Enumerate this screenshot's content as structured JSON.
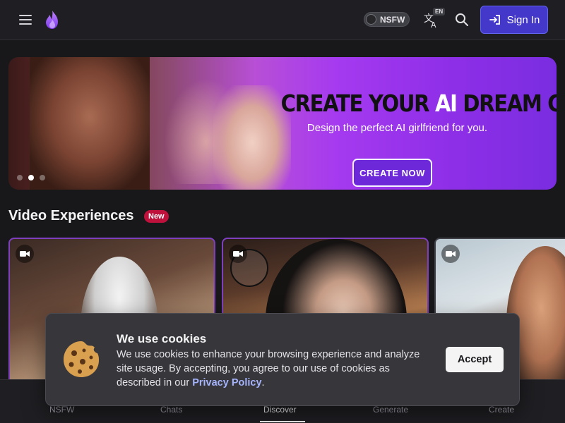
{
  "header": {
    "nsfw_toggle_label": "NSFW",
    "language_badge": "EN",
    "signin_label": "Sign In"
  },
  "banner": {
    "title_part1": "CREATE YOUR ",
    "title_ai": "AI",
    "title_part2": " DREAM GIRL",
    "subtitle": "Design the perfect AI girlfriend for you.",
    "cta_label": "CREATE NOW",
    "slide_count": 3,
    "active_slide": 2
  },
  "section": {
    "title": "Video Experiences",
    "badge": "New"
  },
  "cookie_dialog": {
    "title": "We use cookies",
    "text": "We use cookies to enhance your browsing experience and analyze site usage. By accepting, you agree to our use of cookies as described in our ",
    "link_label": "Privacy Policy",
    "text_end": ".",
    "accept_label": "Accept"
  },
  "bottom_nav": {
    "items": [
      {
        "label": "NSFW"
      },
      {
        "label": "Chats"
      },
      {
        "label": "Discover"
      },
      {
        "label": "Generate"
      },
      {
        "label": "Create"
      }
    ],
    "active": "Discover"
  },
  "colors": {
    "accent": "#4338ca",
    "banner_purple": "#8f2fe8",
    "new_badge": "#be123c",
    "link": "#a5b4fc"
  },
  "icons": [
    "menu-icon",
    "flame-logo-icon",
    "translate-icon",
    "search-icon",
    "sign-in-icon",
    "video-camera-icon",
    "cookie-icon"
  ]
}
